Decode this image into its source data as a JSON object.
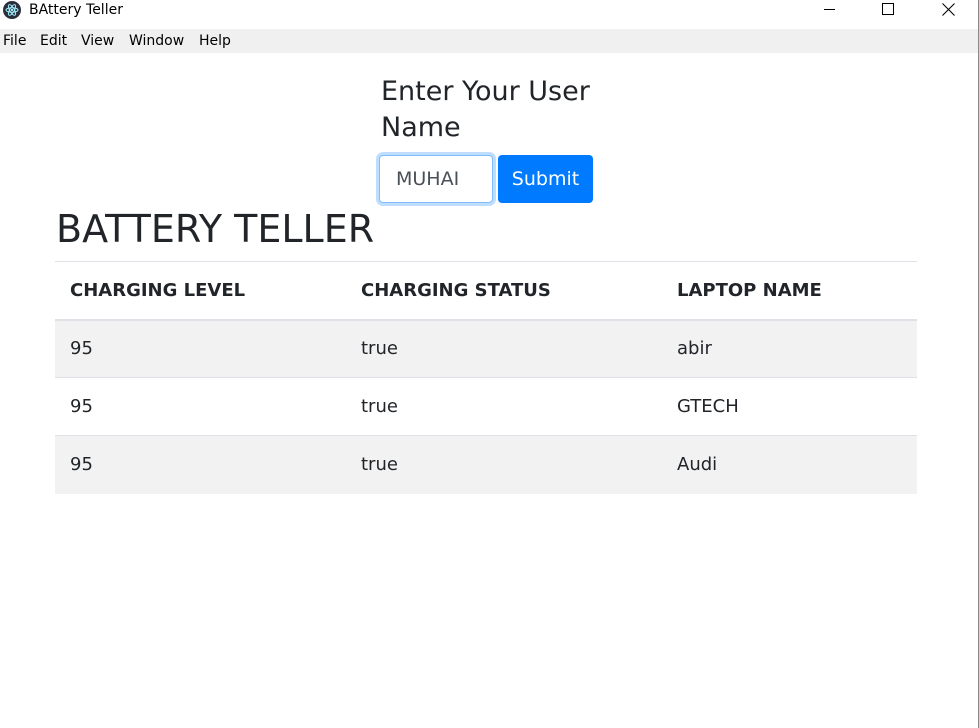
{
  "window": {
    "title": "BAttery Teller"
  },
  "menu": {
    "items": [
      "File",
      "Edit",
      "View",
      "Window",
      "Help"
    ]
  },
  "form": {
    "title": "Enter Your User Name",
    "input_value": "MUHAI",
    "submit_label": "Submit"
  },
  "heading": "BATTERY TELLER",
  "table": {
    "headers": [
      "CHARGING LEVEL",
      "CHARGING STATUS",
      "LAPTOP NAME"
    ],
    "rows": [
      [
        "95",
        "true",
        "abir"
      ],
      [
        "95",
        "true",
        "GTECH"
      ],
      [
        "95",
        "true",
        "Audi"
      ]
    ]
  },
  "colors": {
    "primary": "#007bff",
    "text": "#212529",
    "stripe": "#f2f2f2",
    "menubar": "#f0f0f0"
  },
  "icons": {
    "app": "electron-atom-icon",
    "minimize": "minimize-icon",
    "maximize": "maximize-icon",
    "close": "close-icon"
  }
}
